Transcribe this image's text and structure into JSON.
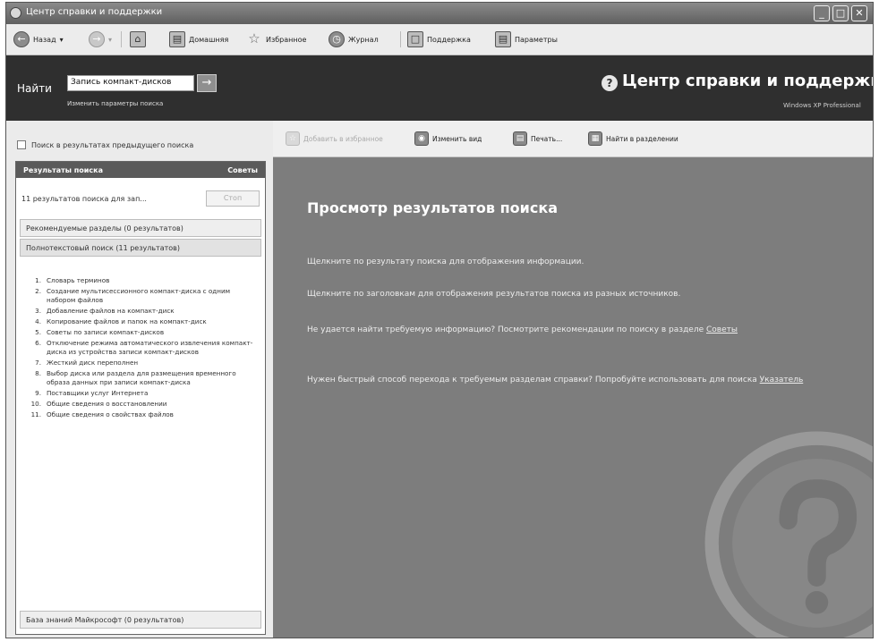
{
  "window": {
    "title": "Центр справки и поддержки",
    "controls": [
      "_",
      "□",
      "✕"
    ]
  },
  "nav": {
    "back": "Назад",
    "home": "Домашняя",
    "favorites": "Избранное",
    "history": "Журнал",
    "support": "Поддержка",
    "options": "Параметры"
  },
  "search": {
    "label": "Найти",
    "value": "Запись компакт-дисков",
    "options_link": "Изменить параметры поиска"
  },
  "brand": {
    "title": "Центр справки и поддержки",
    "subtitle": "Windows XP Professional"
  },
  "left": {
    "prev_results_label": "Поиск в результатах предыдущего поиска",
    "header": "Результаты поиска",
    "header_right": "Советы",
    "count_text": "11 результатов поиска для зап...",
    "stop_label": "Стоп",
    "sections": {
      "suggested": "Рекомендуемые разделы (0 результатов)",
      "fulltext": "Полнотекстовый поиск (11 результатов)",
      "kb": "База знаний Майкрософт (0 результатов)"
    },
    "results": [
      {
        "n": "1.",
        "text": "Словарь терминов"
      },
      {
        "n": "2.",
        "text": "Создание мультисессионного компакт-диска с одним набором файлов"
      },
      {
        "n": "3.",
        "text": "Добавление файлов на компакт-диск"
      },
      {
        "n": "4.",
        "text": "Копирование файлов и папок на компакт-диск"
      },
      {
        "n": "5.",
        "text": "Советы по записи компакт-дисков"
      },
      {
        "n": "6.",
        "text": "Отключение режима автоматического извлечения компакт-диска из устройства записи компакт-дисков"
      },
      {
        "n": "7.",
        "text": "Жесткий диск переполнен"
      },
      {
        "n": "8.",
        "text": "Выбор диска или раздела для размещения временного образа данных при записи компакт-диска"
      },
      {
        "n": "9.",
        "text": "Поставщики услуг Интернета"
      },
      {
        "n": "10.",
        "text": "Общие сведения о восстановлении"
      },
      {
        "n": "11.",
        "text": "Общие сведения о свойствах файлов"
      }
    ]
  },
  "content_toolbar": {
    "add_favorites": "Добавить в избранное",
    "change_view": "Изменить вид",
    "print": "Печать...",
    "find_compat": "Найти в разделении"
  },
  "content": {
    "heading": "Просмотр результатов поиска",
    "p1": "Щелкните по результату поиска для отображения информации.",
    "p2": "Щелкните по заголовкам для отображения результатов поиска из разных источников.",
    "p3_text": "Не удается найти требуемую информацию? Посмотрите рекомендации по поиску в разделе",
    "p3_link": "Советы",
    "p4_text": "Нужен быстрый способ перехода к требуемым разделам справки? Попробуйте использовать для поиска",
    "p4_link": "Указатель"
  }
}
